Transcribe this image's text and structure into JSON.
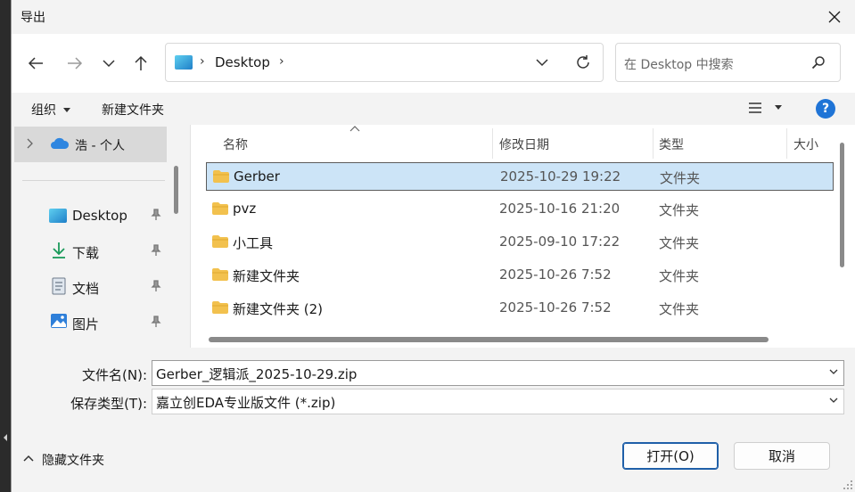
{
  "dialog": {
    "title": "导出"
  },
  "nav": {
    "address_path": "Desktop",
    "search_placeholder": "在 Desktop 中搜索"
  },
  "toolbar": {
    "organize": "组织",
    "new_folder": "新建文件夹",
    "help": "?"
  },
  "sidebar": {
    "onedrive_label": "浩 - 个人",
    "items": [
      {
        "label": "Desktop",
        "icon": "desktop-icon"
      },
      {
        "label": "下载",
        "icon": "download-icon"
      },
      {
        "label": "文档",
        "icon": "document-icon"
      },
      {
        "label": "图片",
        "icon": "pictures-icon"
      }
    ]
  },
  "columns": {
    "name": "名称",
    "modified": "修改日期",
    "type": "类型",
    "size": "大小"
  },
  "files": [
    {
      "name": "Gerber",
      "modified": "2025-10-29 19:22",
      "type": "文件夹",
      "selected": true
    },
    {
      "name": "pvz",
      "modified": "2025-10-16 21:20",
      "type": "文件夹",
      "selected": false
    },
    {
      "name": "小工具",
      "modified": "2025-09-10 17:22",
      "type": "文件夹",
      "selected": false
    },
    {
      "name": "新建文件夹",
      "modified": "2025-10-26 7:52",
      "type": "文件夹",
      "selected": false
    },
    {
      "name": "新建文件夹 (2)",
      "modified": "2025-10-26 7:52",
      "type": "文件夹",
      "selected": false
    }
  ],
  "bottom": {
    "filename_label": "文件名(N):",
    "filename_value": "Gerber_逻辑派_2025-10-29.zip",
    "filetype_label": "保存类型(T):",
    "filetype_value": "嘉立创EDA专业版文件 (*.zip)",
    "hide_folders": "隐藏文件夹",
    "open_button": "打开(O)",
    "cancel_button": "取消"
  },
  "colors": {
    "accent": "#1f74d6",
    "selection": "#cce4f7",
    "folder": "#f2c14e"
  }
}
